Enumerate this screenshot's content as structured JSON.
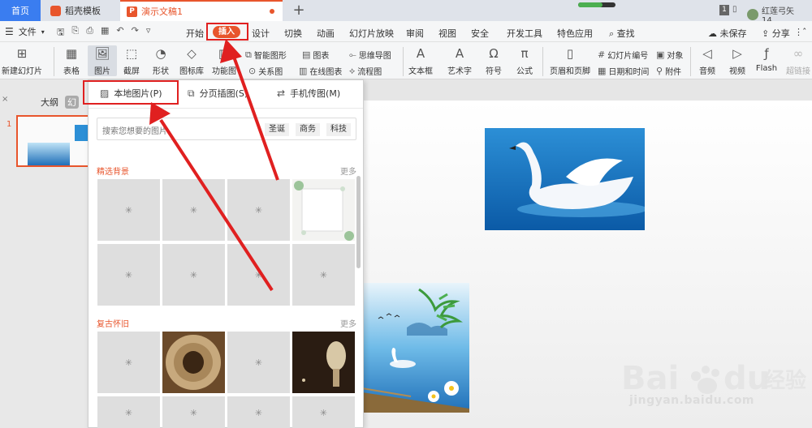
{
  "titlebar": {
    "home_tab": "首页",
    "docer_tab": "稻壳模板",
    "doc_tab": "演示文稿1",
    "new_tab": "+",
    "badge": "1",
    "user_name": "红莲弓矢14...",
    "progress_fraction": 0.65
  },
  "menubar": {
    "file": "文件",
    "items": [
      "开始",
      "插入",
      "设计",
      "切换",
      "动画",
      "幻灯片放映",
      "审阅",
      "视图",
      "安全",
      "开发工具",
      "特色应用"
    ],
    "search": "查找",
    "unsaved": "未保存",
    "share": "分享"
  },
  "ribbon": {
    "new_slide": "新建幻灯片",
    "table": "表格",
    "picture": "图片",
    "screenshot": "截屏",
    "shape": "形状",
    "icon_lib": "图标库",
    "func_chart": "功能图",
    "smart_shape": "智能图形",
    "chart": "图表",
    "mindmap": "思维导图",
    "relation": "关系图",
    "online_chart": "在线图表",
    "flowchart": "流程图",
    "textbox": "文本框",
    "art_text": "艺术字",
    "symbol": "符号",
    "formula": "公式",
    "header_footer": "页眉和页脚",
    "slide_number": "幻灯片编号",
    "date_time": "日期和时间",
    "object": "对象",
    "attachment": "附件",
    "audio": "音频",
    "video": "视频",
    "flash": "Flash",
    "hyperlink": "超链接"
  },
  "leftpanel": {
    "outline_tab": "大纲",
    "slides_tab": "幻",
    "close": "×",
    "slide_number": "1"
  },
  "dropdown": {
    "local_picture": "本地图片(P)",
    "paged_illustration": "分页插图(S)",
    "phone_picture": "手机传图(M)",
    "search_placeholder": "搜索您想要的图片",
    "tags": [
      "圣诞",
      "商务",
      "科技"
    ],
    "section1": "精选背景",
    "section2": "复古怀旧",
    "more": "更多"
  },
  "watermark": {
    "text": "jingyan.baidu.com"
  },
  "colors": {
    "accent": "#e8552c",
    "home_tab": "#3a7df0",
    "highlight_box": "#e02020"
  }
}
